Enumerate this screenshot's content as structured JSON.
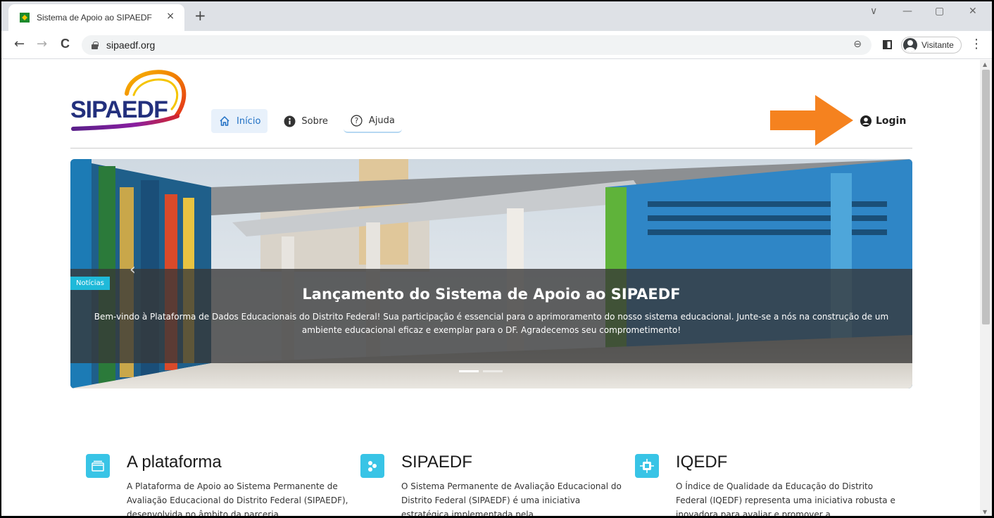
{
  "browser": {
    "tab_title": "Sistema de Apoio ao SIPAEDF",
    "tab_close": "×",
    "new_tab": "+",
    "url": "sipaedf.org",
    "profile_name": "Visitante",
    "back": "←",
    "forward": "→",
    "reload": "C",
    "minimize": "—",
    "restore": "▢",
    "close": "✕",
    "tab_search": "∨",
    "zoom": "⊖",
    "menu": "⋮"
  },
  "header": {
    "logo_text": "SIPAEDF",
    "nav": [
      {
        "label": "Início",
        "icon": "home-icon"
      },
      {
        "label": "Sobre",
        "icon": "info-icon"
      },
      {
        "label": "Ajuda",
        "icon": "help-icon"
      }
    ],
    "login_label": "Login",
    "arrow_color": "#f5821f"
  },
  "hero": {
    "badge": "Notícias",
    "title": "Lançamento do Sistema de Apoio ao SIPAEDF",
    "text": "Bem-vindo à Plataforma de Dados Educacionais do Distrito Federal! Sua participação é essencial para o aprimoramento do nosso sistema educacional. Junte-se a nós na construção de um ambiente educacional eficaz e exemplar para o DF. Agradecemos seu comprometimento!",
    "prev_glyph": "‹"
  },
  "features": [
    {
      "title": "A plataforma",
      "icon": "folder-icon",
      "text": "A Plataforma de Apoio ao Sistema Permanente de Avaliação Educacional do Distrito Federal (SIPAEDF), desenvolvida no âmbito da parceria"
    },
    {
      "title": "SIPAEDF",
      "icon": "network-icon",
      "text": "O Sistema Permanente de Avaliação Educacional do Distrito Federal (SIPAEDF) é uma iniciativa estratégica implementada pela"
    },
    {
      "title": "IQEDF",
      "icon": "chip-icon",
      "text": "O Índice de Qualidade da Educação do Distrito Federal (IQEDF) representa uma iniciativa robusta e inovadora para avaliar e promover a"
    }
  ],
  "colors": {
    "accent": "#1e6fc4",
    "badge": "#1fb9d9",
    "logo_blue": "#23307d"
  }
}
